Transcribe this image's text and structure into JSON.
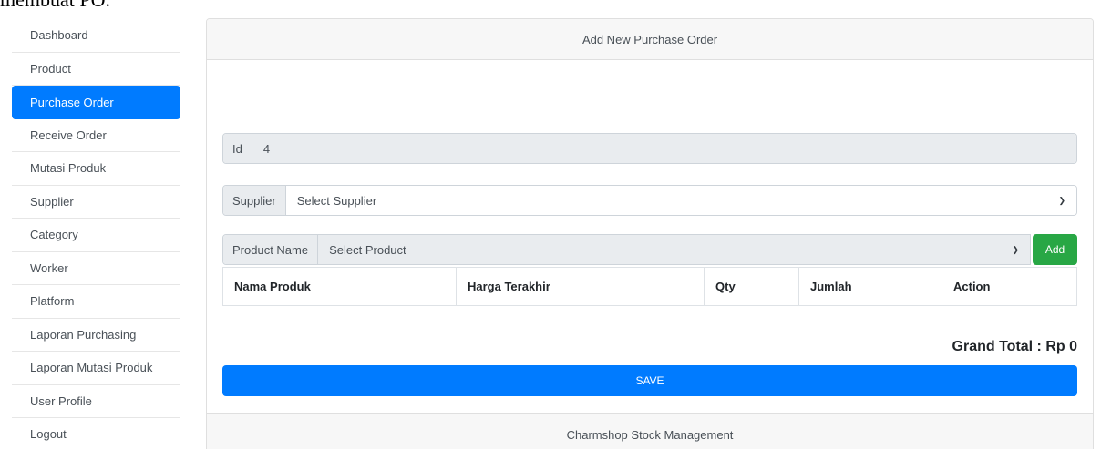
{
  "page": {
    "top_clip_text": "membuat PO."
  },
  "sidebar": {
    "items": [
      {
        "label": "Dashboard"
      },
      {
        "label": "Product"
      },
      {
        "label": "Purchase Order",
        "active": true
      },
      {
        "label": "Receive Order"
      },
      {
        "label": "Mutasi Produk"
      },
      {
        "label": "Supplier"
      },
      {
        "label": "Category"
      },
      {
        "label": "Worker"
      },
      {
        "label": "Platform"
      },
      {
        "label": "Laporan Purchasing"
      },
      {
        "label": "Laporan Mutasi Produk"
      },
      {
        "label": "User Profile"
      },
      {
        "label": "Logout"
      }
    ]
  },
  "form": {
    "title": "Add New Purchase Order",
    "id_label": "Id",
    "id_value": "4",
    "supplier_label": "Supplier",
    "supplier_selected": "Select Supplier",
    "product_label": "Product Name",
    "product_selected": "Select Product",
    "add_label": "Add",
    "table_headers": [
      "Nama Produk",
      "Harga Terakhir",
      "Qty",
      "Jumlah",
      "Action"
    ],
    "grand_total": "Grand Total : Rp 0",
    "save_label": "SAVE",
    "footer": "Charmshop Stock Management"
  },
  "colors": {
    "primary": "#007bff",
    "success": "#28a745",
    "readonly_bg": "#e9ecef"
  }
}
